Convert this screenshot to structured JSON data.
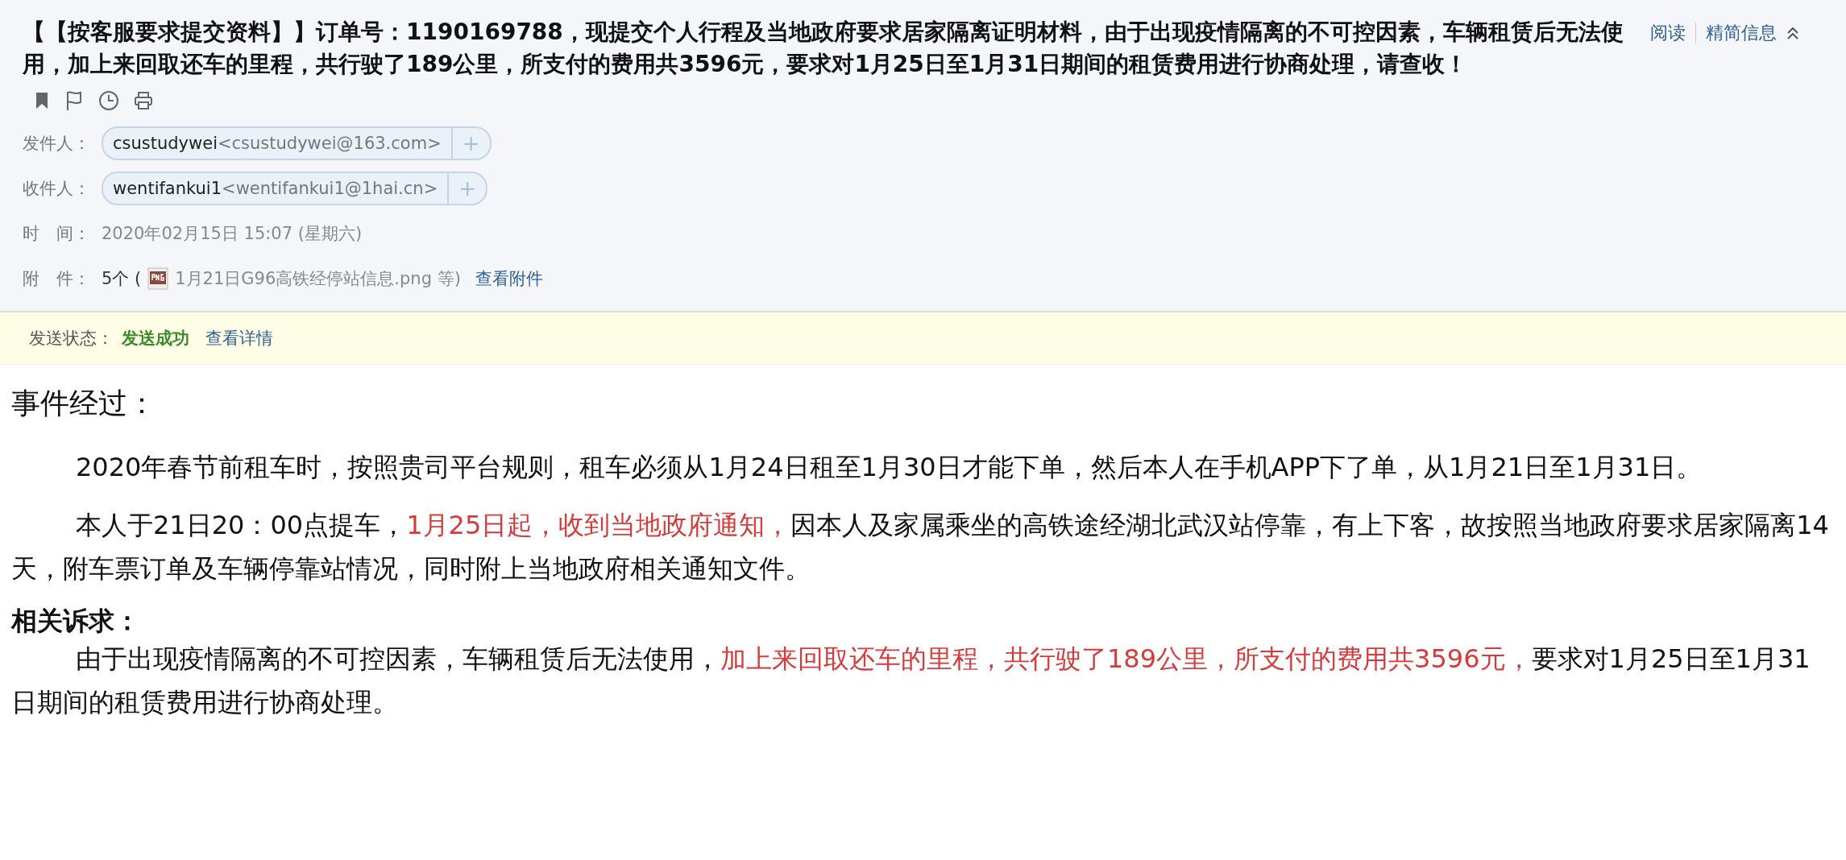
{
  "subject": "【【按客服要求提交资料】】订单号：1190169788，现提交个人行程及当地政府要求居家隔离证明材料，由于出现疫情隔离的不可控因素，车辆租赁后无法使用，加上来回取还车的里程，共行驶了189公里，所支付的费用共3596元，要求对1月25日至1月31日期间的租赁费用进行协商处理，请查收！",
  "top_links": [
    {
      "label": "阅读"
    },
    {
      "label": "精简信息"
    }
  ],
  "sender": {
    "label": "发件人：",
    "name": "csustudywei",
    "address": "<csustudywei@163.com>",
    "add": "+"
  },
  "recipient": {
    "label": "收件人：",
    "name": "wentifankui1",
    "address": "<wentifankui1@1hai.cn>",
    "add": "+"
  },
  "time": {
    "label": "时　间：",
    "value": "2020年02月15日 15:07 (星期六)"
  },
  "attachments": {
    "label": "附　件：",
    "count": "5个 (",
    "file": "1月21日G96高铁经停站信息.png 等)",
    "link": "查看附件"
  },
  "send_status": {
    "label": "发送状态：",
    "value": "发送成功",
    "link": "查看详情"
  },
  "body": [
    {
      "kind": "heading",
      "segments": [
        {
          "text": "事件经过：",
          "emphasis": false
        }
      ]
    },
    {
      "kind": "paragraph",
      "segments": [
        {
          "text": "2020年春节前租车时，按照贵司平台规则，租车必须从1月24日租至1月30日才能下单，然后本人在手机APP下了单，从1月21日至1月31日。",
          "emphasis": false
        }
      ]
    },
    {
      "kind": "paragraph",
      "segments": [
        {
          "text": "本人于21日20：00点提车，",
          "emphasis": false
        },
        {
          "text": "1月25日起，收到当地政府通知，",
          "emphasis": true
        },
        {
          "text": "因本人及家属乘坐的高铁途经湖北武汉站停靠，有上下客，故按照当地政府要求居家隔离14天，附车票订单及车辆停靠站情况，同时附上当地政府相关通知文件。",
          "emphasis": false
        }
      ]
    },
    {
      "kind": "subheading",
      "segments": [
        {
          "text": "相关诉求：",
          "emphasis": false
        }
      ]
    },
    {
      "kind": "paragraph",
      "segments": [
        {
          "text": "由于出现疫情隔离的不可控因素，车辆租赁后无法使用，",
          "emphasis": false
        },
        {
          "text": "加上来回取还车的里程，共行驶了189公里，所支付的费用共3596元，",
          "emphasis": true
        },
        {
          "text": "要求对1月25日至1月31日期间的租赁费用进行协商处理。",
          "emphasis": false
        }
      ]
    }
  ]
}
